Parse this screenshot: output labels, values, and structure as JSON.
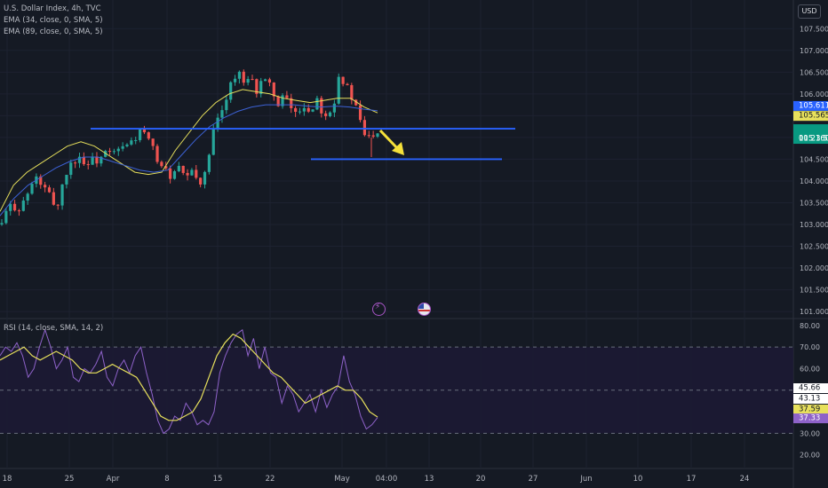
{
  "legend": {
    "title": "U.S. Dollar Index, 4h, TVC",
    "ema1": "EMA (34, close, 0, SMA, 5)",
    "ema2": "EMA (89, close, 0, SMA, 5)",
    "rsi": "RSI (14, close, SMA, 14, 2)"
  },
  "currency": "USD",
  "colors": {
    "up": "#26a69a",
    "down": "#ef5350",
    "ema34": "#e7e05c",
    "ema89": "#3d62d6",
    "hline": "#2962ff",
    "arrow": "#f5e13a",
    "rsi": "#8e62c9",
    "rsi_ma": "#e7e05c"
  },
  "chart_data": [
    {
      "type": "candlestick",
      "title": "U.S. Dollar Index, 4h, TVC",
      "x_ticks": [
        "18",
        "25",
        "Apr",
        "8",
        "15",
        "22",
        "May",
        "04:00",
        "13",
        "20",
        "27",
        "Jun",
        "10",
        "17",
        "24"
      ],
      "y_ticks": [
        107.5,
        107.0,
        106.5,
        106.0,
        105.5,
        105.0,
        104.5,
        104.0,
        103.5,
        103.0,
        102.5,
        102.0,
        101.5,
        101.0
      ],
      "ylim": [
        100.9,
        107.75
      ],
      "close_path": [
        103.0,
        103.35,
        103.45,
        103.35,
        103.55,
        103.75,
        104.1,
        103.95,
        103.75,
        103.6,
        103.35,
        103.95,
        104.3,
        104.45,
        104.6,
        104.35,
        104.5,
        104.45,
        104.55,
        104.65,
        104.6,
        104.7,
        104.75,
        104.85,
        104.95,
        105.15,
        105.05,
        104.8,
        104.55,
        104.35,
        104.15,
        104.1,
        104.3,
        104.05,
        104.2,
        104.1,
        104.0,
        104.15,
        105.05,
        105.35,
        105.65,
        106.15,
        106.35,
        106.45,
        106.15,
        106.35,
        106.05,
        106.35,
        106.2,
        106.15,
        105.7,
        105.95,
        105.75,
        105.55,
        105.65,
        105.75,
        105.55,
        105.95,
        105.6,
        105.55,
        105.75,
        106.45,
        106.25,
        106.0,
        105.7,
        105.3,
        104.95,
        105.1,
        105.16
      ],
      "ema34": [
        103.3,
        103.9,
        104.2,
        104.4,
        104.6,
        104.8,
        104.9,
        104.8,
        104.6,
        104.4,
        104.2,
        104.15,
        104.2,
        104.7,
        105.1,
        105.5,
        105.8,
        106.0,
        106.1,
        106.05,
        106.0,
        105.9,
        105.85,
        105.8,
        105.85,
        105.9,
        105.9,
        105.7,
        105.565
      ],
      "ema89": [
        103.2,
        103.6,
        103.9,
        104.1,
        104.3,
        104.45,
        104.55,
        104.55,
        104.45,
        104.35,
        104.25,
        104.2,
        104.25,
        104.6,
        104.95,
        105.25,
        105.45,
        105.6,
        105.7,
        105.75,
        105.75,
        105.75,
        105.72,
        105.7,
        105.72,
        105.7,
        105.65,
        105.611
      ],
      "hlines": [
        105.2,
        104.5
      ],
      "price_labels": [
        {
          "label": "105.611",
          "value": 105.611,
          "color": "#2962ff"
        },
        {
          "label": "105.565",
          "value": 105.565,
          "color": "#e7e05c"
        },
        {
          "label": "105.160",
          "value": 105.16,
          "color": "#089981"
        },
        {
          "label": "01:23:58",
          "value": null,
          "color": "#089981"
        }
      ]
    },
    {
      "type": "line",
      "title": "RSI (14, close, SMA, 14, 2)",
      "y_ticks": [
        80.0,
        70.0,
        60.0,
        50.0,
        40.0,
        30.0,
        20.0
      ],
      "ylim": [
        17,
        82
      ],
      "bands": [
        70,
        50,
        30
      ],
      "rsi": [
        66,
        70,
        68,
        72,
        66,
        56,
        60,
        70,
        78,
        70,
        60,
        64,
        70,
        56,
        54,
        60,
        58,
        62,
        68,
        56,
        52,
        60,
        64,
        58,
        66,
        70,
        58,
        48,
        36,
        30,
        32,
        38,
        36,
        44,
        40,
        34,
        36,
        34,
        40,
        58,
        66,
        72,
        76,
        78,
        66,
        74,
        60,
        70,
        58,
        56,
        44,
        52,
        48,
        40,
        44,
        48,
        40,
        50,
        42,
        48,
        52,
        66,
        54,
        48,
        38,
        32,
        34,
        37.33
      ],
      "rsi_ma": [
        64,
        66,
        68,
        70,
        66,
        64,
        66,
        68,
        66,
        64,
        60,
        58,
        58,
        60,
        62,
        60,
        58,
        56,
        50,
        44,
        38,
        36,
        36,
        38,
        40,
        46,
        56,
        66,
        72,
        76,
        74,
        70,
        66,
        62,
        58,
        56,
        52,
        48,
        44,
        46,
        48,
        50,
        52,
        50,
        50,
        46,
        40,
        37.59
      ],
      "price_labels": [
        {
          "label": "45.66",
          "value": 45.66,
          "color": "#ffffff"
        },
        {
          "label": "43.13",
          "value": 43.13,
          "color": "#ffffff"
        },
        {
          "label": "37.59",
          "value": 37.59,
          "color": "#e7e05c"
        },
        {
          "label": "37.33",
          "value": 37.33,
          "color": "#8e62c9"
        }
      ]
    }
  ]
}
